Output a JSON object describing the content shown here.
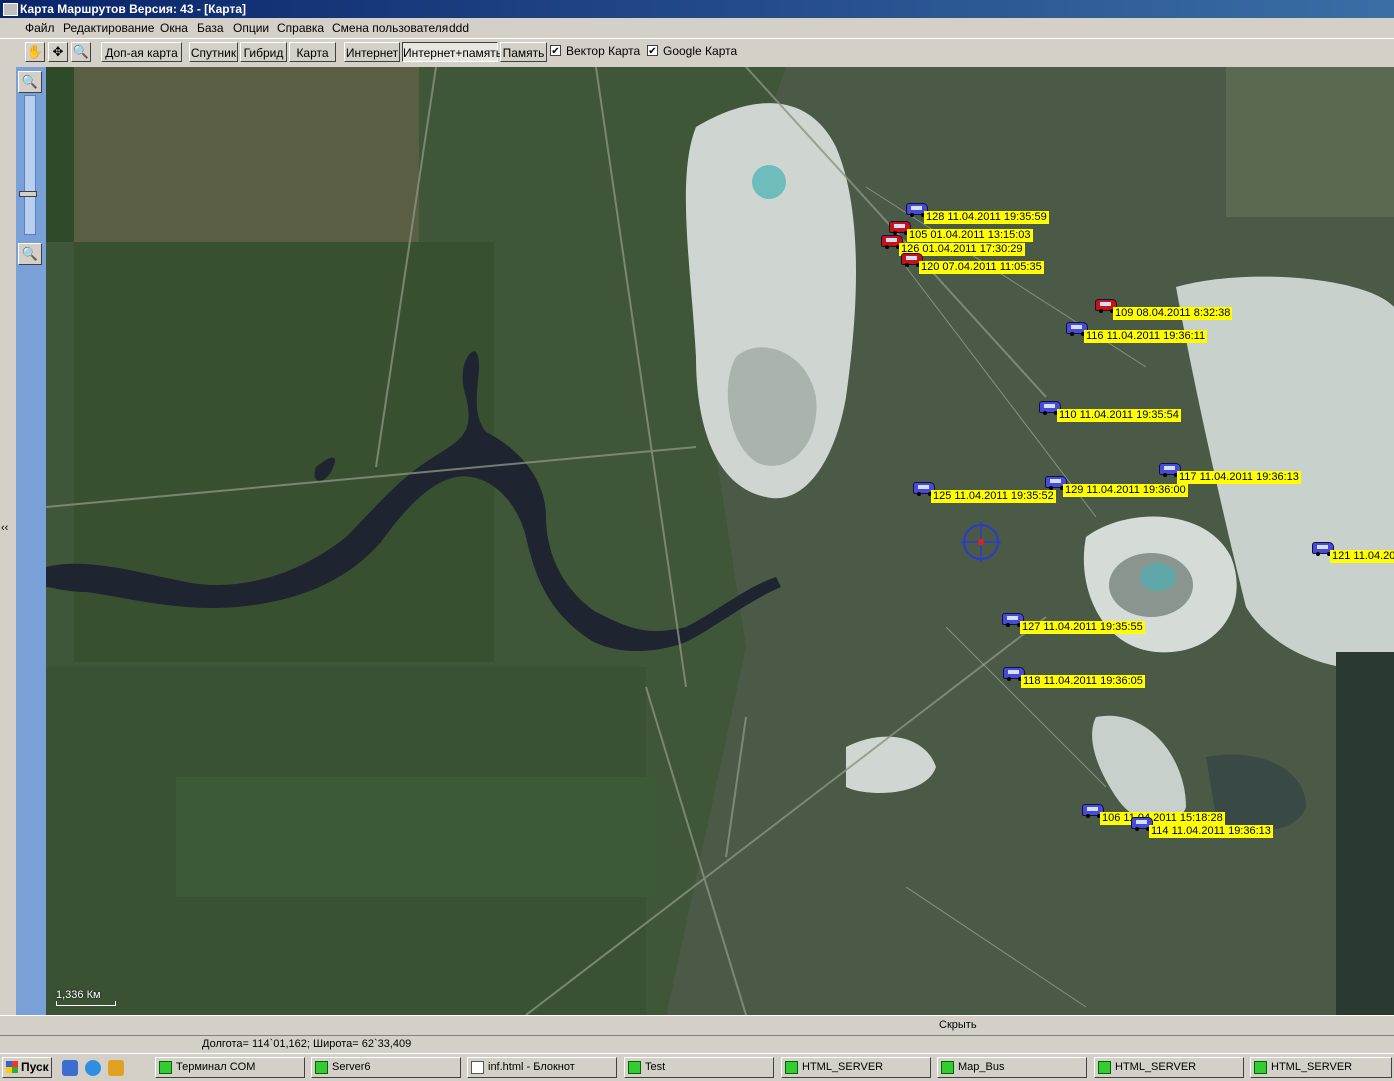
{
  "window": {
    "title": "Карта Маршрутов Версия: 43 - [Карта]"
  },
  "menu": [
    "Файл",
    "Редактирование",
    "Окна",
    "База",
    "Опции",
    "Справка",
    "Смена пользователя",
    "ddd"
  ],
  "toolbar": {
    "buttons": [
      "Доп-ая карта",
      "Спутник",
      "Гибрид",
      "Карта",
      "Интернет",
      "Интернет+память",
      "Память"
    ],
    "checkbox_vector": "Вектор Карта",
    "checkbox_google": "Google Карта"
  },
  "vehicles": [
    {
      "label": "128 11.04.2011 19:35:59",
      "color": "#4a4ad8"
    },
    {
      "label": "105 01.04.2011 13:15:03",
      "color": "#cc1111"
    },
    {
      "label": "126 01.04.2011 17:30:29",
      "color": "#cc1111"
    },
    {
      "label": "120 07.04.2011 11:05:35",
      "color": "#cc1111"
    },
    {
      "label": "109 08.04.2011 8:32:38",
      "color": "#cc1111"
    },
    {
      "label": "116 11.04.2011 19:36:11",
      "color": "#4a4ad8"
    },
    {
      "label": "110 11.04.2011 19:35:54",
      "color": "#4a4ad8"
    },
    {
      "label": "117 11.04.2011 19:36:13",
      "color": "#4a4ad8"
    },
    {
      "label": "129 11.04.2011 19:36:00",
      "color": "#4a4ad8"
    },
    {
      "label": "125 11.04.2011 19:35:52",
      "color": "#4a4ad8"
    },
    {
      "label": "121 11.04.20",
      "color": "#4a4ad8"
    },
    {
      "label": "127 11.04.2011 19:35:55",
      "color": "#4a4ad8"
    },
    {
      "label": "118 11.04.2011 19:36:05",
      "color": "#4a4ad8"
    },
    {
      "label": "106 11.04.2011 15:18:28",
      "color": "#4a4ad8"
    },
    {
      "label": "114 11.04.2011 19:36:13",
      "color": "#4a4ad8"
    }
  ],
  "scale": "1,336 Км",
  "hide_button": "Скрыть",
  "status": {
    "coords": "Долгота= 114`01,162; Широта= 62`33,409"
  },
  "taskbar": {
    "start": "Пуск",
    "tasks": [
      "Терминал COM",
      "Server6",
      "inf.html - Блокнот",
      "Test",
      "HTML_SERVER",
      "Map_Bus",
      "HTML_SERVER",
      "HTML_SERVER"
    ]
  }
}
